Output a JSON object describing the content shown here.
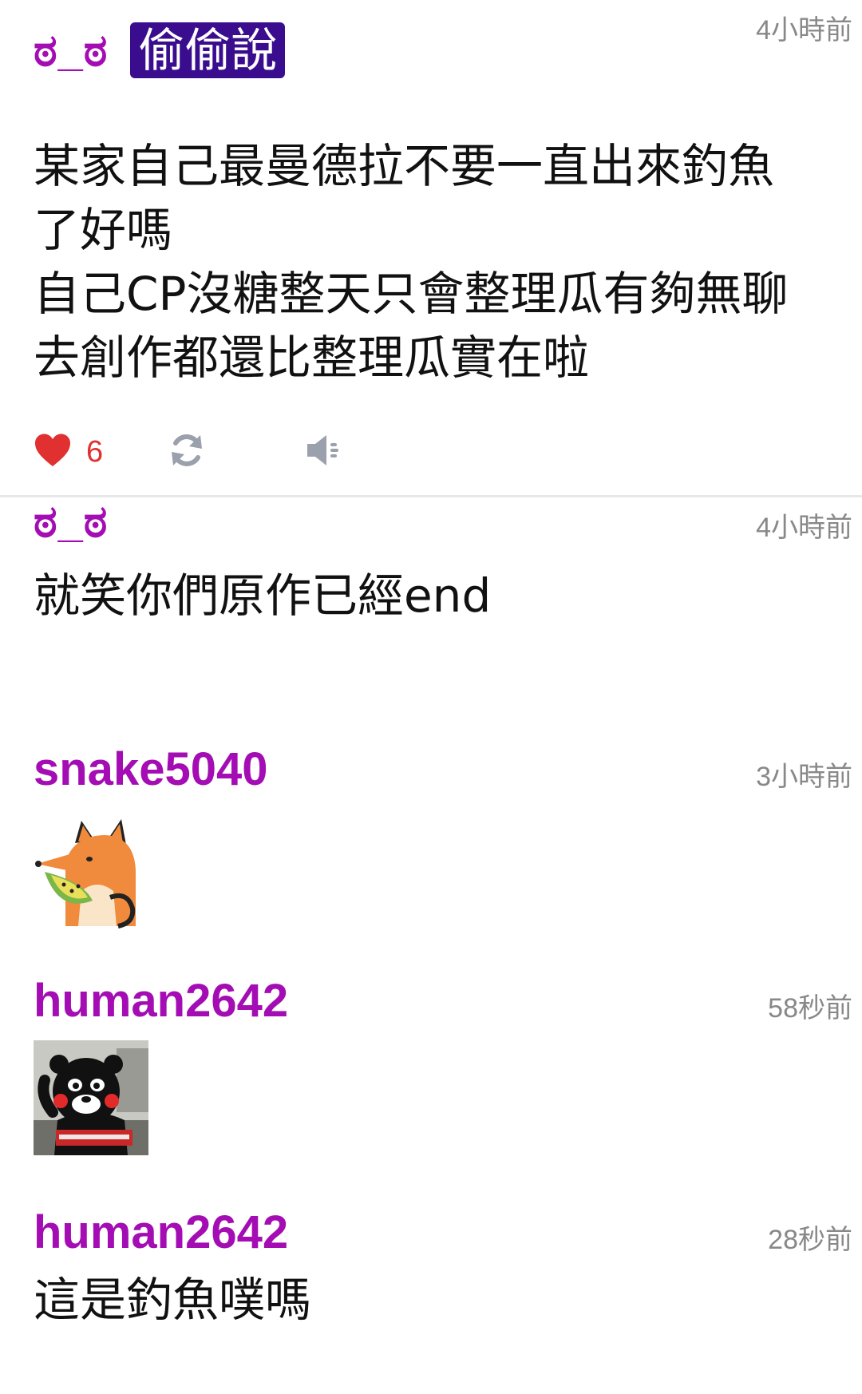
{
  "post": {
    "author": "ಠ_ಠ",
    "tag": "偷偷說",
    "time": "4小時前",
    "body_lines": [
      "某家自己最曼德拉不要一直出來釣魚",
      "了好嗎",
      "自己CP沒糖整天只會整理瓜有夠無聊",
      "去創作都還比整理瓜實在啦"
    ],
    "likes": "6",
    "icons": {
      "like": "heart-icon",
      "repost": "refresh-icon",
      "speaker": "speaker-icon"
    }
  },
  "replies": [
    {
      "author": "ಠ_ಠ",
      "time": "4小時前",
      "text": "就笑你們原作已經end"
    },
    {
      "author": "snake5040",
      "time": "3小時前",
      "sticker": "fox-eating-melon-sticker"
    },
    {
      "author": "human2642",
      "time": "58秒前",
      "sticker": "kumamon-waving-sticker"
    },
    {
      "author": "human2642",
      "time": "28秒前",
      "text": "這是釣魚噗嗎"
    }
  ],
  "colors": {
    "username": "#a30db3",
    "tag_bg": "#3a0d8f",
    "like": "#e03030",
    "icon_gray": "#9aa0ac",
    "timestamp": "#888888"
  }
}
